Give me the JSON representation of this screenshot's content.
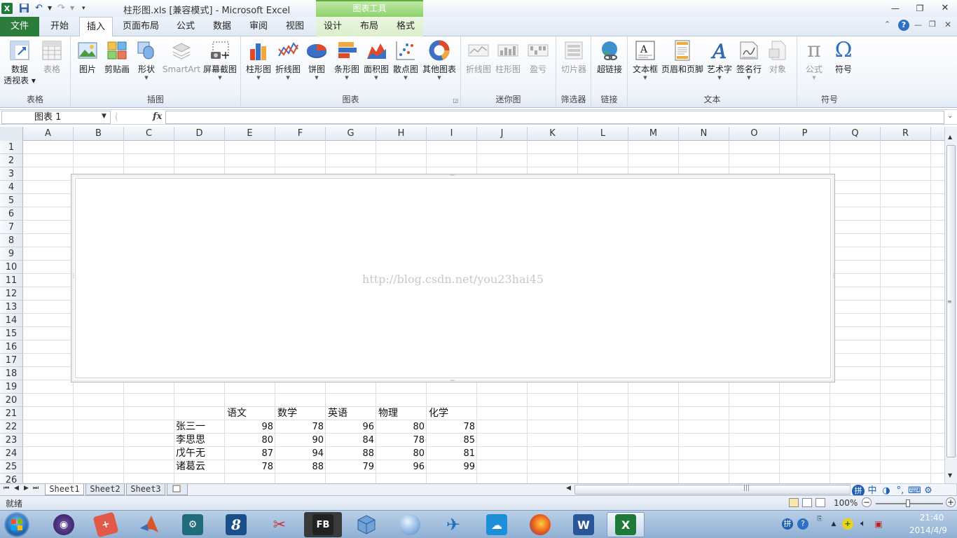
{
  "window": {
    "title": "柱形图.xls  [兼容模式] - Microsoft Excel",
    "context_tab_title": "图表工具"
  },
  "tabs": [
    {
      "label": "文件"
    },
    {
      "label": "开始"
    },
    {
      "label": "插入"
    },
    {
      "label": "页面布局"
    },
    {
      "label": "公式"
    },
    {
      "label": "数据"
    },
    {
      "label": "审阅"
    },
    {
      "label": "视图"
    },
    {
      "label": "设计"
    },
    {
      "label": "布局"
    },
    {
      "label": "格式"
    }
  ],
  "ribbon": {
    "groups": {
      "table": "表格",
      "illustration": "插图",
      "chart": "图表",
      "sparkline": "迷你图",
      "filter": "筛选器",
      "link": "链接",
      "text": "文本",
      "symbol": "符号"
    },
    "buttons": {
      "pivot_line1": "数据",
      "pivot_line2": "透视表",
      "table": "表格",
      "picture": "图片",
      "clipart": "剪贴画",
      "shapes": "形状",
      "smartart": "SmartArt",
      "screenshot": "屏幕截图",
      "column": "柱形图",
      "line": "折线图",
      "pie": "饼图",
      "bar": "条形图",
      "area": "面积图",
      "scatter": "散点图",
      "other": "其他图表",
      "spark_line": "折线图",
      "spark_column": "柱形图",
      "spark_winloss": "盈亏",
      "slicer": "切片器",
      "hyperlink": "超链接",
      "textbox": "文本框",
      "header_footer": "页眉和页脚",
      "wordart": "艺术字",
      "signature": "签名行",
      "object": "对象",
      "equation": "公式",
      "symbol": "符号"
    }
  },
  "formula_bar": {
    "name_box": "图表 1",
    "fx": "fx",
    "formula": ""
  },
  "columns": [
    "A",
    "B",
    "C",
    "D",
    "E",
    "F",
    "G",
    "H",
    "I",
    "J",
    "K",
    "L",
    "M",
    "N",
    "O",
    "P",
    "Q",
    "R"
  ],
  "rows": [
    "1",
    "2",
    "3",
    "4",
    "5",
    "6",
    "7",
    "8",
    "9",
    "10",
    "11",
    "12",
    "13",
    "14",
    "15",
    "16",
    "17",
    "18",
    "19",
    "20",
    "21",
    "22",
    "23",
    "24",
    "25",
    "26"
  ],
  "table": {
    "headers": [
      "语文",
      "数学",
      "英语",
      "物理",
      "化学"
    ],
    "students": [
      {
        "name": "张三一",
        "scores": [
          "98",
          "78",
          "96",
          "80",
          "78"
        ]
      },
      {
        "name": "李思思",
        "scores": [
          "80",
          "90",
          "84",
          "78",
          "85"
        ]
      },
      {
        "name": "戊午无",
        "scores": [
          "87",
          "94",
          "88",
          "80",
          "81"
        ]
      },
      {
        "name": "诸葛云",
        "scores": [
          "78",
          "88",
          "79",
          "96",
          "99"
        ]
      }
    ]
  },
  "chart": {
    "watermark": "http://blog.csdn.net/you23hai45"
  },
  "sheets": [
    "Sheet1",
    "Sheet2",
    "Sheet3"
  ],
  "status": {
    "ready": "就绪",
    "zoom": "100%"
  },
  "ime": {
    "mode": "中"
  },
  "clock": {
    "time": "21:40",
    "date": "2014/4/9"
  }
}
